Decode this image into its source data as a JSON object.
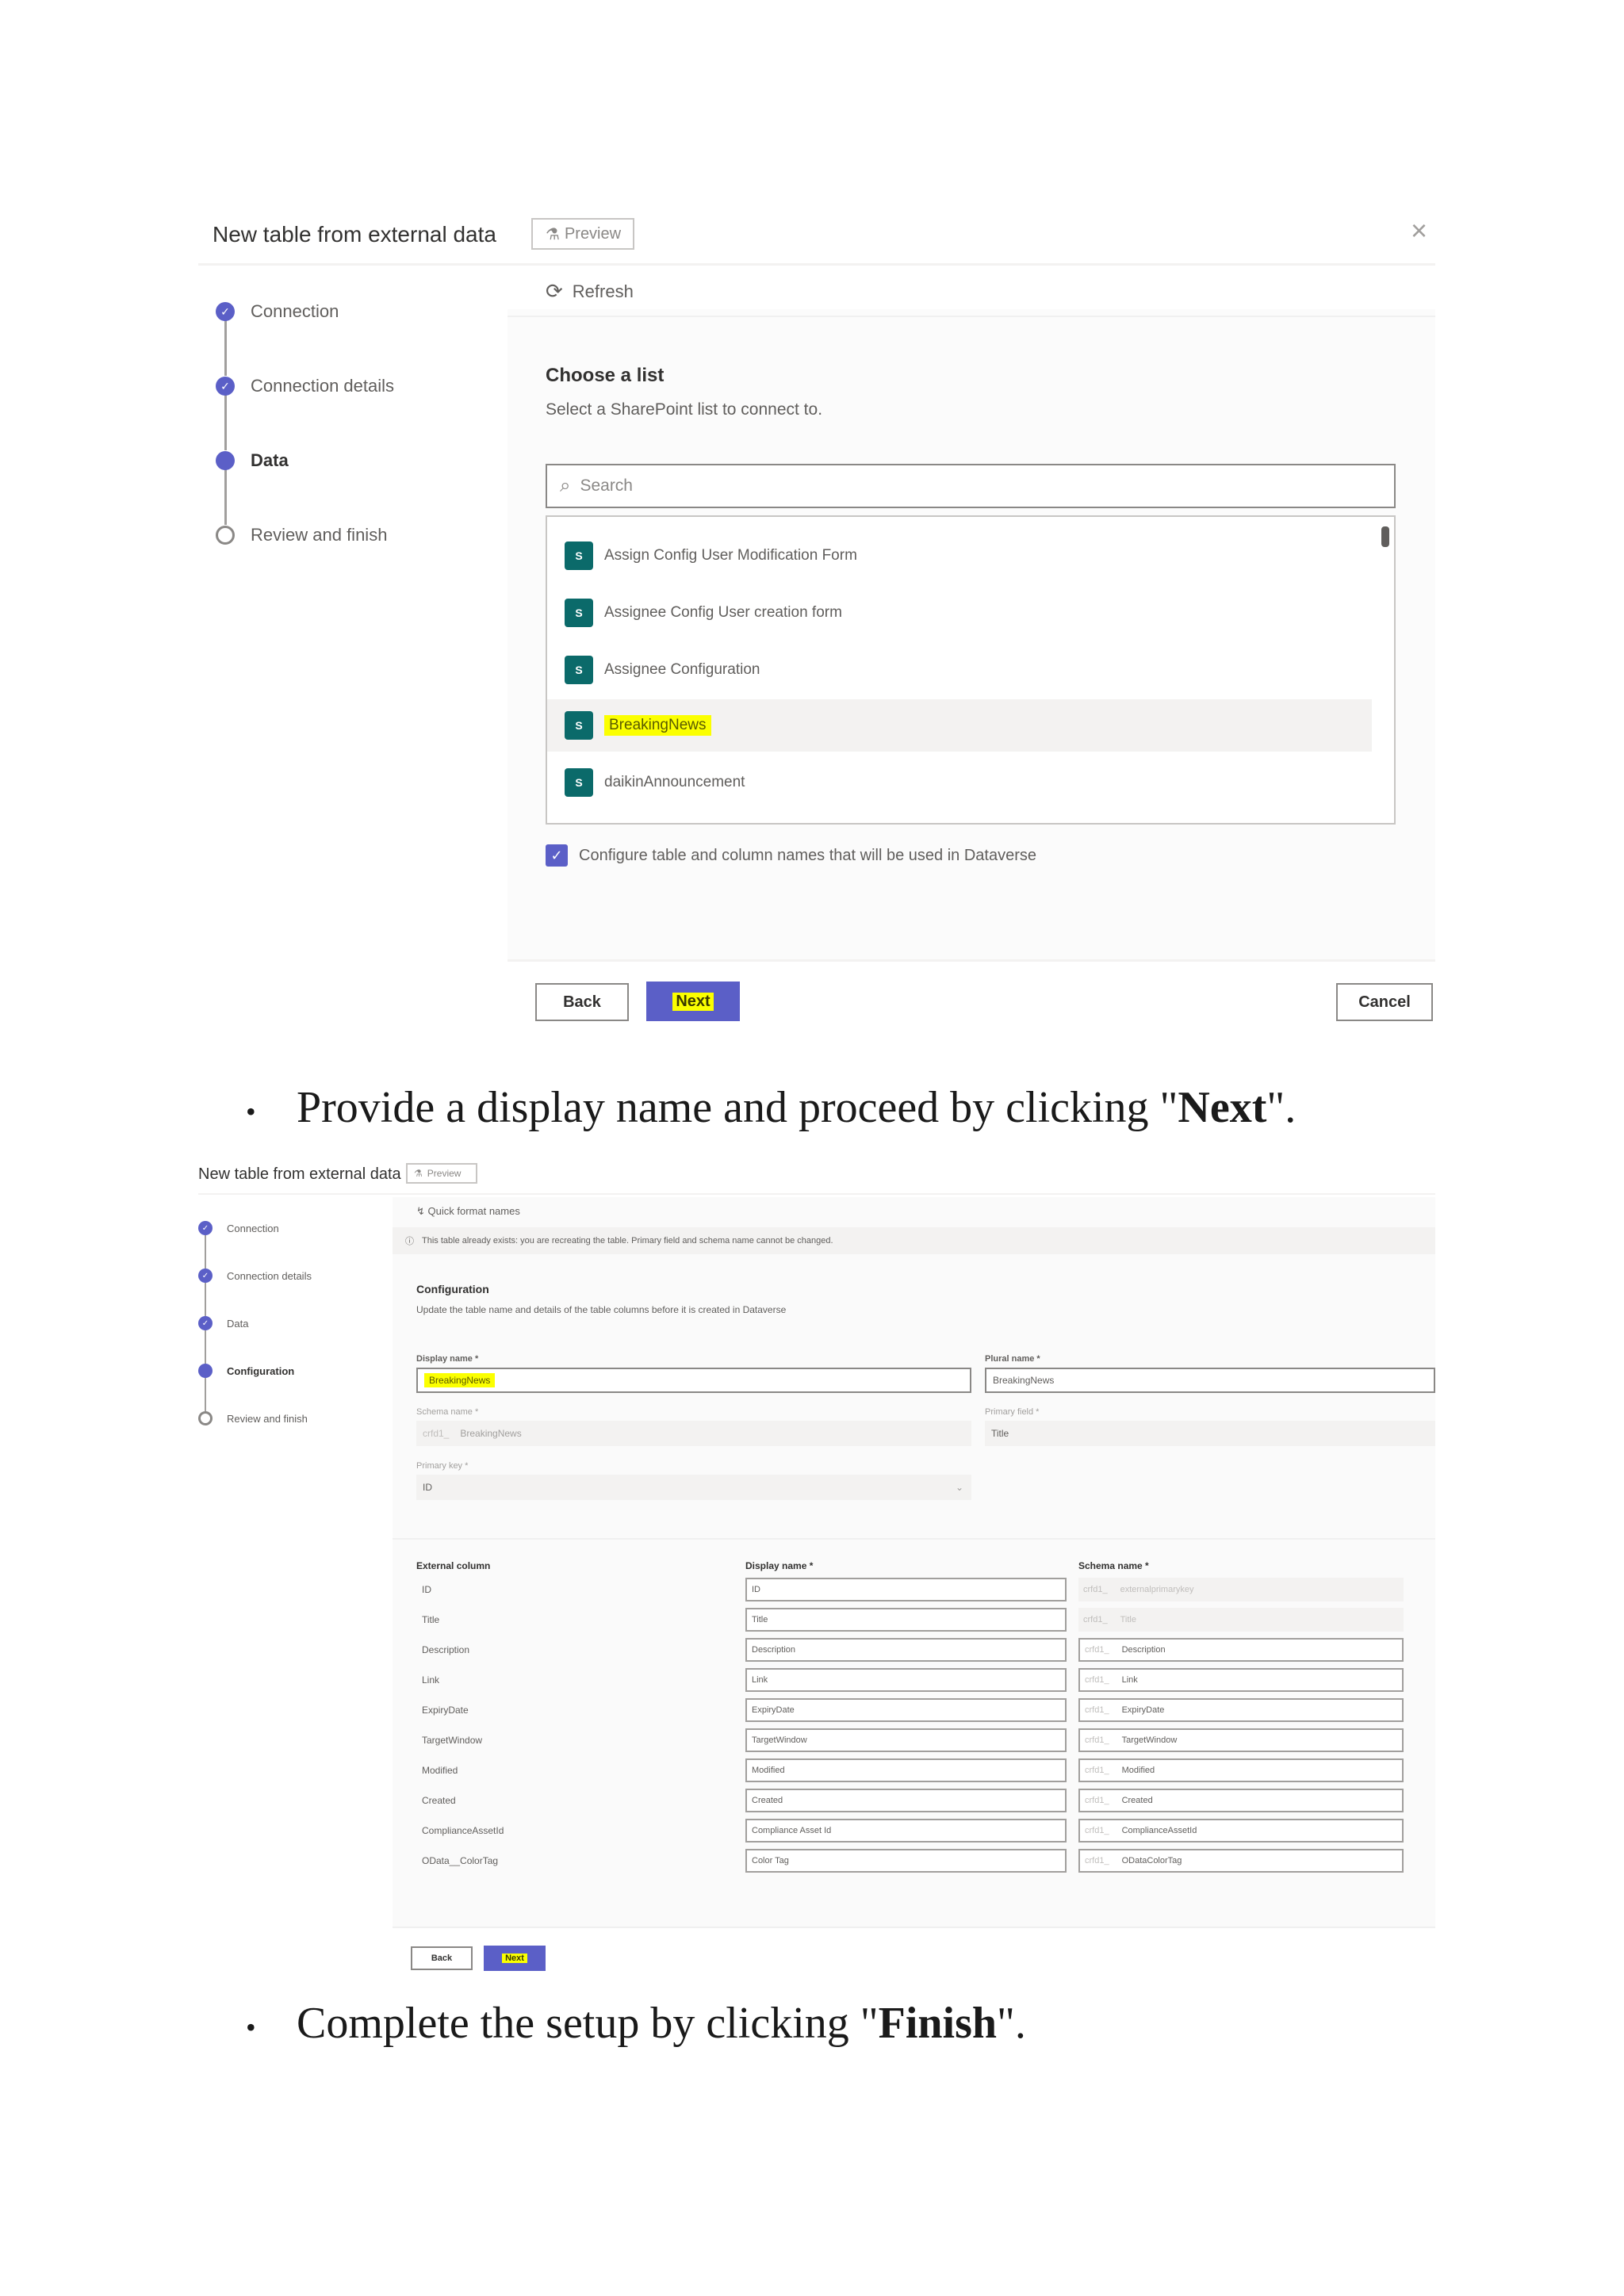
{
  "panel1": {
    "title": "New table from external data",
    "preview_label": "Preview",
    "close_glyph": "×",
    "steps": [
      {
        "label": "Connection",
        "state": "done"
      },
      {
        "label": "Connection details",
        "state": "done"
      },
      {
        "label": "Data",
        "state": "current"
      },
      {
        "label": "Review and finish",
        "state": "pending"
      }
    ],
    "refresh_label": "Refresh",
    "heading": "Choose a list",
    "subheading": "Select a SharePoint list to connect to.",
    "search_placeholder": "Search",
    "list_items": [
      "Assign Config User Modification Form",
      "Assignee Config User creation form",
      "Assignee Configuration",
      "BreakingNews",
      "daikinAnnouncement"
    ],
    "selected_item": "BreakingNews",
    "checkbox_label": "Configure table and column names that will be used in Dataverse",
    "back_label": "Back",
    "next_label": "Next",
    "cancel_label": "Cancel"
  },
  "bullet1": {
    "prefix": "Provide a display name and proceed by clicking \"",
    "bold": "Next",
    "suffix": "\"."
  },
  "panel2": {
    "title": "New table from external data",
    "preview_label": "Preview",
    "steps": [
      {
        "label": "Connection",
        "state": "done"
      },
      {
        "label": "Connection details",
        "state": "done"
      },
      {
        "label": "Data",
        "state": "done"
      },
      {
        "label": "Configuration",
        "state": "current"
      },
      {
        "label": "Review and finish",
        "state": "pending"
      }
    ],
    "quick_format": "Quick format names",
    "banner_text": "This table already exists: you are recreating the table. Primary field and schema name cannot be changed.",
    "config_heading": "Configuration",
    "config_sub": "Update the table name and details of the table columns before it is created in Dataverse",
    "display_name_label": "Display name *",
    "display_name_value": "BreakingNews",
    "plural_name_label": "Plural name *",
    "plural_name_value": "BreakingNews",
    "schema_name_label": "Schema name *",
    "schema_prefix": "crfd1_",
    "schema_name_value": "BreakingNews",
    "primary_field_label": "Primary field *",
    "primary_field_value": "Title",
    "primary_key_label": "Primary key *",
    "primary_key_value": "ID",
    "columns_header": {
      "external": "External column",
      "display": "Display name *",
      "schema": "Schema name *"
    },
    "columns": [
      {
        "external": "ID",
        "display": "ID",
        "schema_prefix": "crfd1_",
        "schema": "externalprimarykey",
        "schema_readonly": true
      },
      {
        "external": "Title",
        "display": "Title",
        "schema_prefix": "crfd1_",
        "schema": "Title",
        "schema_readonly": true
      },
      {
        "external": "Description",
        "display": "Description",
        "schema_prefix": "crfd1_",
        "schema": "Description",
        "schema_readonly": false
      },
      {
        "external": "Link",
        "display": "Link",
        "schema_prefix": "crfd1_",
        "schema": "Link",
        "schema_readonly": false
      },
      {
        "external": "ExpiryDate",
        "display": "ExpiryDate",
        "schema_prefix": "crfd1_",
        "schema": "ExpiryDate",
        "schema_readonly": false
      },
      {
        "external": "TargetWindow",
        "display": "TargetWindow",
        "schema_prefix": "crfd1_",
        "schema": "TargetWindow",
        "schema_readonly": false
      },
      {
        "external": "Modified",
        "display": "Modified",
        "schema_prefix": "crfd1_",
        "schema": "Modified",
        "schema_readonly": false
      },
      {
        "external": "Created",
        "display": "Created",
        "schema_prefix": "crfd1_",
        "schema": "Created",
        "schema_readonly": false
      },
      {
        "external": "ComplianceAssetId",
        "display": "Compliance Asset Id",
        "schema_prefix": "crfd1_",
        "schema": "ComplianceAssetId",
        "schema_readonly": false
      },
      {
        "external": "OData__ColorTag",
        "display": "Color Tag",
        "schema_prefix": "crfd1_",
        "schema": "ODataColorTag",
        "schema_readonly": false
      }
    ],
    "back_label": "Back",
    "next_label": "Next"
  },
  "bullet2": {
    "prefix": "Complete the setup by clicking \"",
    "bold": "Finish",
    "suffix": "\"."
  },
  "colors": {
    "accent": "#5b5fc7",
    "highlight": "#fbff00",
    "sharepoint_icon": "#0b6a6a"
  }
}
